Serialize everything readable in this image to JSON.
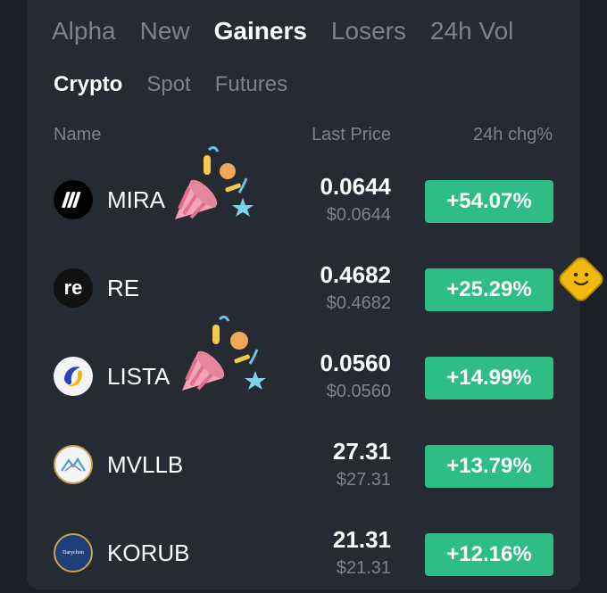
{
  "tabs": [
    {
      "label": "Alpha",
      "active": false
    },
    {
      "label": "New",
      "active": false
    },
    {
      "label": "Gainers",
      "active": true
    },
    {
      "label": "Losers",
      "active": false
    },
    {
      "label": "24h Vol",
      "active": false
    }
  ],
  "subtabs": [
    {
      "label": "Crypto",
      "active": true
    },
    {
      "label": "Spot",
      "active": false
    },
    {
      "label": "Futures",
      "active": false
    }
  ],
  "columns": {
    "name": "Name",
    "price": "Last Price",
    "change": "24h chg%"
  },
  "rows": [
    {
      "symbol": "MIRA",
      "price": "0.0644",
      "price_usd": "$0.0644",
      "change": "+54.07%",
      "icon": "mira-logo-icon"
    },
    {
      "symbol": "RE",
      "price": "0.4682",
      "price_usd": "$0.4682",
      "change": "+25.29%",
      "icon": "re-logo-icon",
      "logo_text": "re"
    },
    {
      "symbol": "LISTA",
      "price": "0.0560",
      "price_usd": "$0.0560",
      "change": "+14.99%",
      "icon": "lista-logo-icon"
    },
    {
      "symbol": "MVLLB",
      "price": "27.31",
      "price_usd": "$27.31",
      "change": "+13.79%",
      "icon": "mvllb-logo-icon"
    },
    {
      "symbol": "KORUB",
      "price": "21.31",
      "price_usd": "$21.31",
      "change": "+12.16%",
      "icon": "korub-logo-icon",
      "logo_text": "Darychon"
    }
  ],
  "colors": {
    "background": "#1b1f26",
    "panel": "#262a32",
    "positive": "#2ebd85",
    "muted_text": "#7d838c",
    "text": "#ffffff"
  }
}
